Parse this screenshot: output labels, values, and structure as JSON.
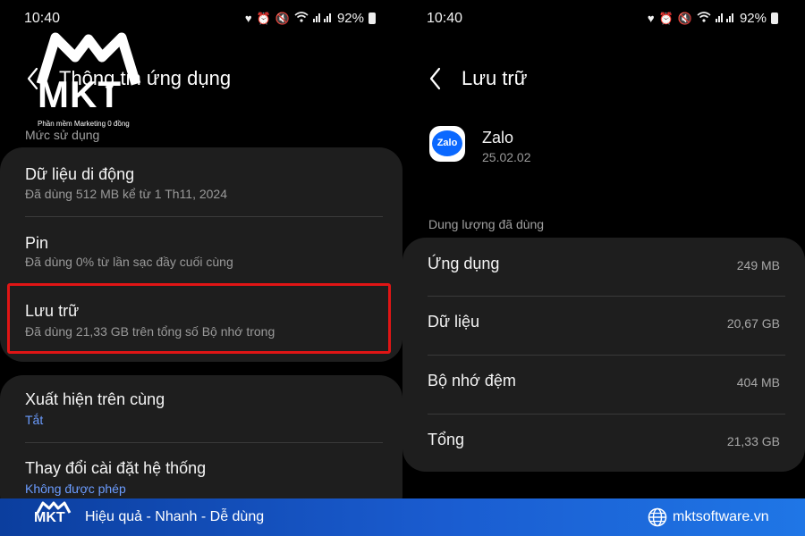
{
  "status_bar": {
    "time": "10:40",
    "battery": "92%"
  },
  "left": {
    "header_title": "Thông tin ứng dụng",
    "section_label": "Mức sử dụng",
    "items": [
      {
        "title": "Dữ liệu di động",
        "subtitle": "Đã dùng 512 MB kể từ 1 Th11, 2024"
      },
      {
        "title": "Pin",
        "subtitle": "Đã dùng 0% từ lần sạc đầy cuối cùng"
      },
      {
        "title": "Lưu trữ",
        "subtitle": "Đã dùng 21,33 GB trên tổng số Bộ nhớ trong"
      }
    ],
    "items2": [
      {
        "title": "Xuất hiện trên cùng",
        "subtitle": "Tắt"
      },
      {
        "title": "Thay đổi cài đặt hệ thống",
        "subtitle": "Không được phép"
      }
    ]
  },
  "right": {
    "header_title": "Lưu trữ",
    "app": {
      "icon_text": "Zalo",
      "name": "Zalo",
      "version": "25.02.02"
    },
    "section_label": "Dung lượng đã dùng",
    "usage": [
      {
        "label": "Ứng dụng",
        "value": "249 MB"
      },
      {
        "label": "Dữ liệu",
        "value": "20,67 GB"
      },
      {
        "label": "Bộ nhớ đệm",
        "value": "404 MB"
      },
      {
        "label": "Tổng",
        "value": "21,33 GB"
      }
    ]
  },
  "watermark": {
    "brand": "MKT",
    "tagline": "Phần mềm Marketing 0 đồng"
  },
  "footer": {
    "brand": "MKT",
    "slogan": "Hiệu quả - Nhanh - Dễ dùng",
    "website": "mktsoftware.vn"
  },
  "colors": {
    "highlight": "#e01515",
    "link_blue": "#6b9cff",
    "card_bg": "#1e1e1e",
    "footer_blue": "#1a5cd0"
  },
  "icons": [
    "back-icon",
    "heart-icon",
    "alarm-icon",
    "mute-icon",
    "wifi-icon",
    "signal-icon",
    "battery-icon",
    "globe-icon"
  ]
}
